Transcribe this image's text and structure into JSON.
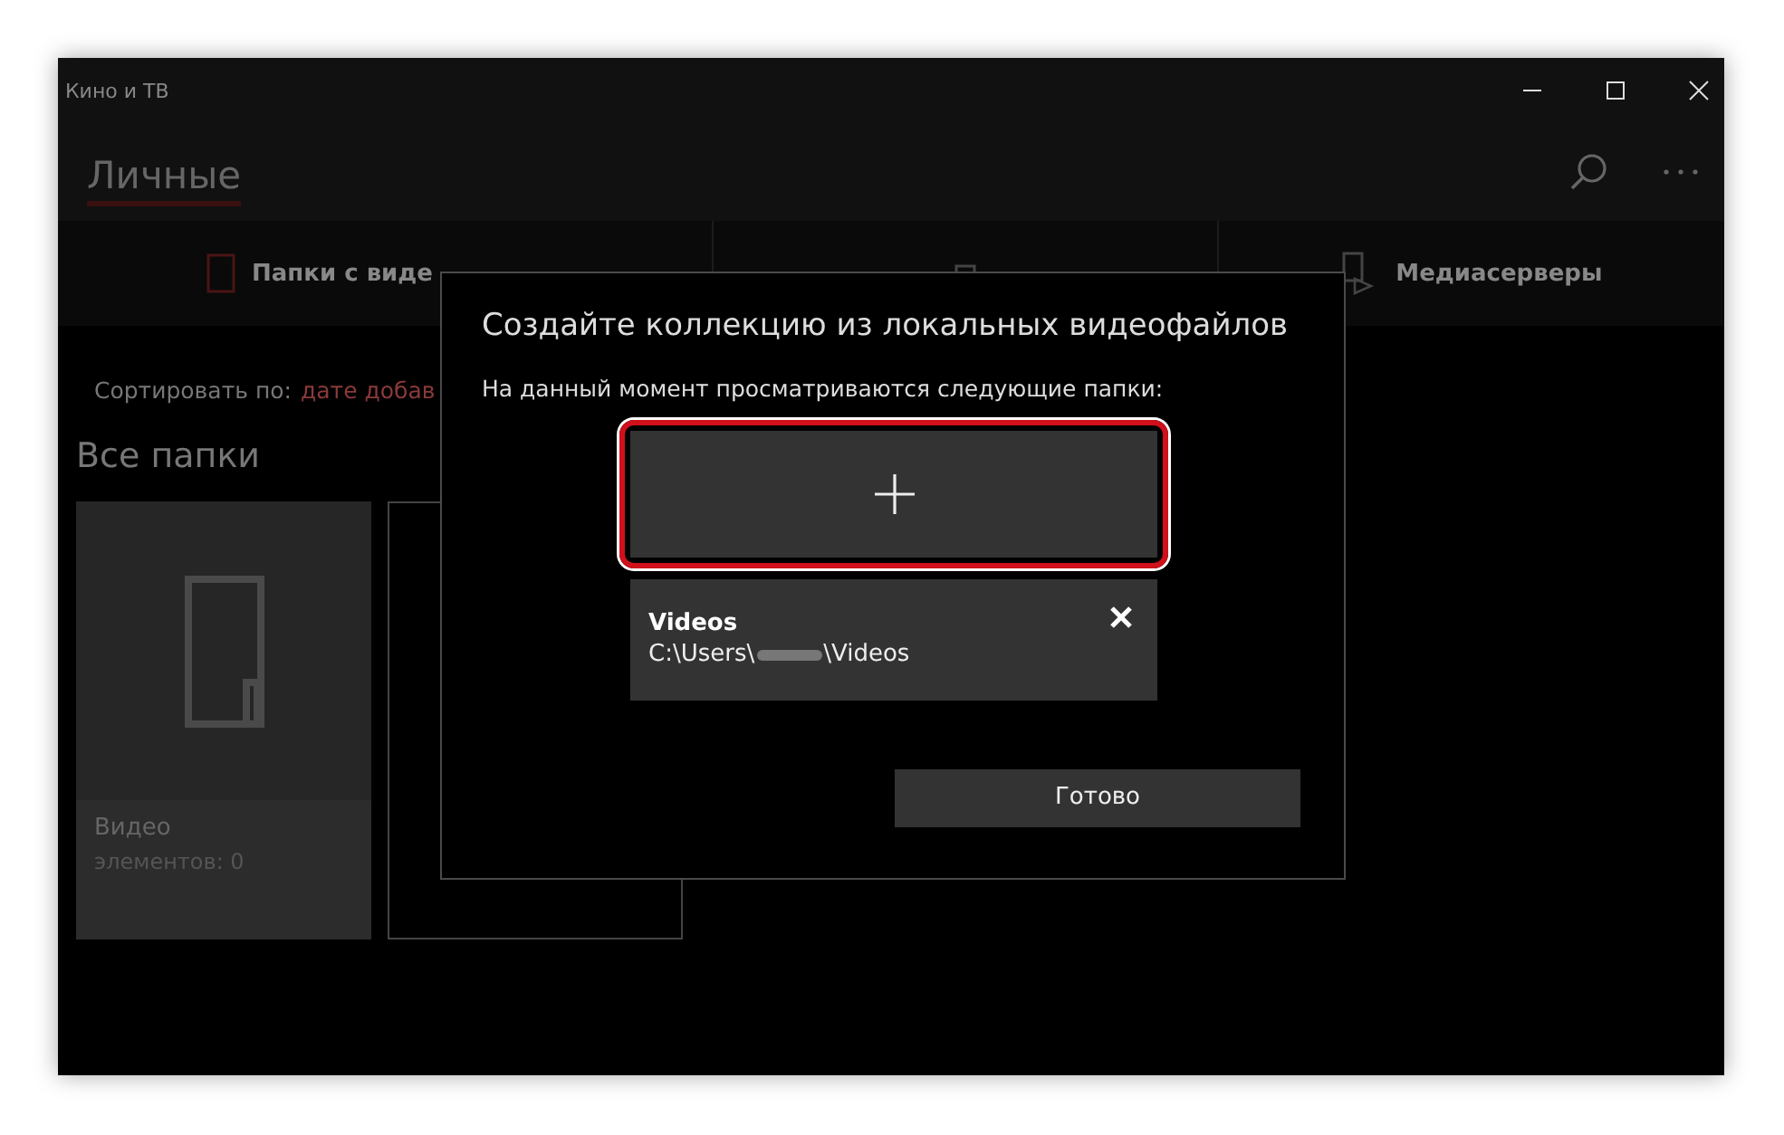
{
  "window": {
    "title": "Кино и ТВ"
  },
  "header": {
    "title": "Личные"
  },
  "tabs": [
    {
      "label": "Папки с виде",
      "kind": "folder",
      "selected": true
    },
    {
      "kind": "device",
      "selected": false
    },
    {
      "label": "Медиасерверы",
      "kind": "server",
      "selected": false
    }
  ],
  "sort": {
    "label": "Сортировать по:",
    "value": "дате добав"
  },
  "section_title": "Все папки",
  "cards": [
    {
      "kind": "folder",
      "name": "Видео",
      "count": "элементов: 0"
    },
    {
      "kind": "add"
    }
  ],
  "dialog": {
    "title": "Создайте коллекцию из локальных видеофайлов",
    "subtitle": "На данный момент просматриваются следующие папки:",
    "add_button": {
      "highlighted": true
    },
    "folders": [
      {
        "name": "Videos",
        "path_start": "C:\\Users\\",
        "path_end": "\\Videos",
        "redacted": true
      }
    ],
    "done_button": "Готово"
  }
}
